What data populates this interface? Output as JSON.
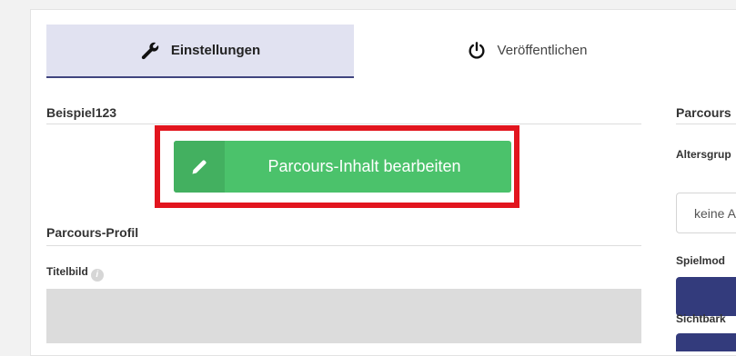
{
  "tabs": {
    "settings": {
      "label": "Einstellungen",
      "icon": "wrench-icon"
    },
    "publish": {
      "label": "Veröffentlichen",
      "icon": "power-icon"
    }
  },
  "main": {
    "section_title": "Beispiel123",
    "edit_button": {
      "label": "Parcours-Inhalt bearbeiten",
      "icon": "pencil-icon"
    },
    "profile_title": "Parcours-Profil",
    "cover_label": "Titelbild"
  },
  "right": {
    "section_title": "Parcours",
    "age_label": "Altersgrup",
    "age_value": "keine A",
    "mode_label": "Spielmod",
    "visibility_label": "Sichtbark"
  },
  "colors": {
    "accent": "#333b7c",
    "button_green": "#4bc26b",
    "highlight_red": "#e2151e",
    "tab_active_bg": "#e1e2f1"
  }
}
